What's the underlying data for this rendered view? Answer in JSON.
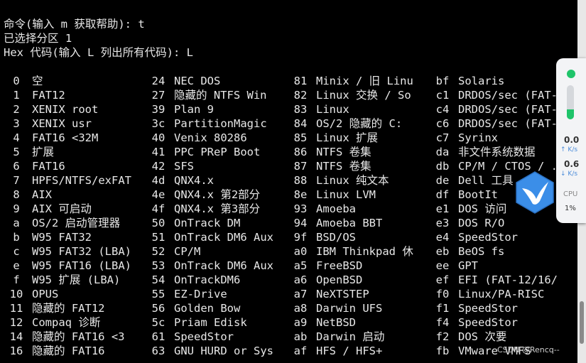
{
  "terminal": {
    "prompt_lines": [
      "命令(输入 m 获取帮助): t",
      "已选择分区 1",
      "Hex 代码(输入 L 列出所有代码): L"
    ],
    "partition_types": [
      [
        [
          "0",
          "空"
        ],
        [
          "24",
          "NEC DOS"
        ],
        [
          "81",
          "Minix / 旧 Linu"
        ],
        [
          "bf",
          "Solaris"
        ]
      ],
      [
        [
          "1",
          "FAT12"
        ],
        [
          "27",
          "隐藏的 NTFS Win"
        ],
        [
          "82",
          "Linux 交换 / So"
        ],
        [
          "c1",
          "DRDOS/sec (FAT-"
        ]
      ],
      [
        [
          "2",
          "XENIX root"
        ],
        [
          "39",
          "Plan 9"
        ],
        [
          "83",
          "Linux"
        ],
        [
          "c4",
          "DRDOS/sec (FAT-"
        ]
      ],
      [
        [
          "3",
          "XENIX usr"
        ],
        [
          "3c",
          "PartitionMagic"
        ],
        [
          "84",
          "OS/2 隐藏的 C:"
        ],
        [
          "c6",
          "DRDOS/sec (FAT-"
        ]
      ],
      [
        [
          "4",
          "FAT16 <32M"
        ],
        [
          "40",
          "Venix 80286"
        ],
        [
          "85",
          "Linux 扩展"
        ],
        [
          "c7",
          "Syrinx"
        ]
      ],
      [
        [
          "5",
          "扩展"
        ],
        [
          "41",
          "PPC PReP Boot"
        ],
        [
          "86",
          "NTFS 卷集"
        ],
        [
          "da",
          "非文件系统数据"
        ]
      ],
      [
        [
          "6",
          "FAT16"
        ],
        [
          "42",
          "SFS"
        ],
        [
          "87",
          "NTFS 卷集"
        ],
        [
          "db",
          "CP/M / CTOS / ."
        ]
      ],
      [
        [
          "7",
          "HPFS/NTFS/exFAT"
        ],
        [
          "4d",
          "QNX4.x"
        ],
        [
          "88",
          "Linux 纯文本"
        ],
        [
          "de",
          "Dell 工具"
        ]
      ],
      [
        [
          "8",
          "AIX"
        ],
        [
          "4e",
          "QNX4.x 第2部分"
        ],
        [
          "8e",
          "Linux LVM"
        ],
        [
          "df",
          "BootIt"
        ]
      ],
      [
        [
          "9",
          "AIX 可启动"
        ],
        [
          "4f",
          "QNX4.x 第3部分"
        ],
        [
          "93",
          "Amoeba"
        ],
        [
          "e1",
          "DOS 访问"
        ]
      ],
      [
        [
          "a",
          "OS/2 启动管理器"
        ],
        [
          "50",
          "OnTrack DM"
        ],
        [
          "94",
          "Amoeba BBT"
        ],
        [
          "e3",
          "DOS R/O"
        ]
      ],
      [
        [
          "b",
          "W95 FAT32"
        ],
        [
          "51",
          "OnTrack DM6 Aux"
        ],
        [
          "9f",
          "BSD/OS"
        ],
        [
          "e4",
          "SpeedStor"
        ]
      ],
      [
        [
          "c",
          "W95 FAT32 (LBA)"
        ],
        [
          "52",
          "CP/M"
        ],
        [
          "a0",
          "IBM Thinkpad 休"
        ],
        [
          "eb",
          "BeOS fs"
        ]
      ],
      [
        [
          "e",
          "W95 FAT16 (LBA)"
        ],
        [
          "53",
          "OnTrack DM6 Aux"
        ],
        [
          "a5",
          "FreeBSD"
        ],
        [
          "ee",
          "GPT"
        ]
      ],
      [
        [
          "f",
          "W95 扩展 (LBA)"
        ],
        [
          "54",
          "OnTrackDM6"
        ],
        [
          "a6",
          "OpenBSD"
        ],
        [
          "ef",
          "EFI (FAT-12/16/"
        ]
      ],
      [
        [
          "10",
          "OPUS"
        ],
        [
          "55",
          "EZ-Drive"
        ],
        [
          "a7",
          "NeXTSTEP"
        ],
        [
          "f0",
          "Linux/PA-RISC"
        ]
      ],
      [
        [
          "11",
          "隐藏的 FAT12"
        ],
        [
          "56",
          "Golden Bow"
        ],
        [
          "a8",
          "Darwin UFS"
        ],
        [
          "f1",
          "SpeedStor"
        ]
      ],
      [
        [
          "12",
          "Compaq 诊断"
        ],
        [
          "5c",
          "Priam Edisk"
        ],
        [
          "a9",
          "NetBSD"
        ],
        [
          "f4",
          "SpeedStor"
        ]
      ],
      [
        [
          "14",
          "隐藏的 FAT16 <3"
        ],
        [
          "61",
          "SpeedStor"
        ],
        [
          "ab",
          "Darwin 启动"
        ],
        [
          "f2",
          "DOS 次要"
        ]
      ],
      [
        [
          "16",
          "隐藏的 FAT16"
        ],
        [
          "63",
          "GNU HURD or Sys"
        ],
        [
          "af",
          "HFS / HFS+"
        ],
        [
          "fb",
          "VMware VMFS"
        ]
      ]
    ]
  },
  "monitor_widget": {
    "upload_value": "0.0",
    "upload_unit": "K/s",
    "download_value": "0.6",
    "download_unit": "K/s",
    "cpu_label": "CPU",
    "cpu_value": "1%",
    "memory_level": 0.3,
    "colors": {
      "status": "#1fc46a",
      "bird": "#3b8ee8"
    }
  },
  "watermark": "CSDN @Rencq--"
}
